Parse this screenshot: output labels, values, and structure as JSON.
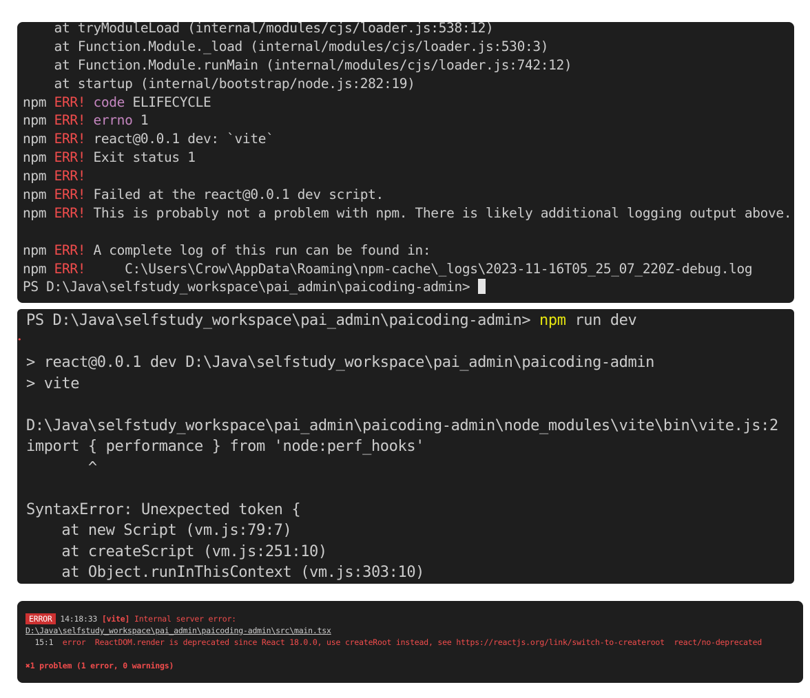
{
  "terminal1": {
    "stack": [
      "    at tryModuleLoad (internal/modules/cjs/loader.js:538:12)",
      "    at Function.Module._load (internal/modules/cjs/loader.js:530:3)",
      "    at Function.Module.runMain (internal/modules/cjs/loader.js:742:12)",
      "    at startup (internal/bootstrap/node.js:282:19)"
    ],
    "npm": "npm",
    "err": "ERR!",
    "code_kw": "code",
    "code_val": "ELIFECYCLE",
    "errno_kw": "errno",
    "errno_val": "1",
    "msg_dev": "react@0.0.1 dev: `vite`",
    "msg_exit": "Exit status 1",
    "msg_failed": "Failed at the react@0.0.1 dev script.",
    "msg_probably": "This is probably not a problem with npm. There is likely additional logging output above.",
    "msg_log": "A complete log of this run can be found in:",
    "msg_logpath": "    C:\\Users\\Crow\\AppData\\Roaming\\npm-cache\\_logs\\2023-11-16T05_25_07_220Z-debug.log",
    "prompt": "PS D:\\Java\\selfstudy_workspace\\pai_admin\\paicoding-admin>"
  },
  "terminal2": {
    "prompt": "PS D:\\Java\\selfstudy_workspace\\pai_admin\\paicoding-admin>",
    "cmd_npm": "npm",
    "cmd_rest": "run dev",
    "script_line": "> react@0.0.1 dev D:\\Java\\selfstudy_workspace\\pai_admin\\paicoding-admin",
    "vite_line": "> vite",
    "path_line": "D:\\Java\\selfstudy_workspace\\pai_admin\\paicoding-admin\\node_modules\\vite\\bin\\vite.js:2",
    "import_line": "import { performance } from 'node:perf_hooks'",
    "caret_line": "       ^",
    "syntax_error": "SyntaxError: Unexpected token {",
    "stack": [
      "    at new Script (vm.js:79:7)",
      "    at createScript (vm.js:251:10)",
      "    at Object.runInThisContext (vm.js:303:10)"
    ]
  },
  "terminal3": {
    "badge": "ERROR",
    "time": "14:18:33",
    "tag": "[vite]",
    "msg": "Internal server error:",
    "file": "D:\\Java\\selfstudy_workspace\\pai_admin\\paicoding-admin\\src\\main.tsx",
    "pos": "  15:1",
    "severity": "error",
    "detail": "ReactDOM.render is deprecated since React 18.0.0, use createRoot instead, see https://reactjs.org/link/switch-to-createroot  react/no-deprecated",
    "problem_icon": "✖",
    "summary": "1 problem (1 error, 0 warnings)"
  },
  "colors": {
    "background": "#1e1e1e",
    "text": "#cccccc",
    "error_red": "#f14c4c",
    "keyword_magenta": "#c586c0",
    "command_yellow": "#e5e510",
    "badge_red": "#cd3131"
  }
}
